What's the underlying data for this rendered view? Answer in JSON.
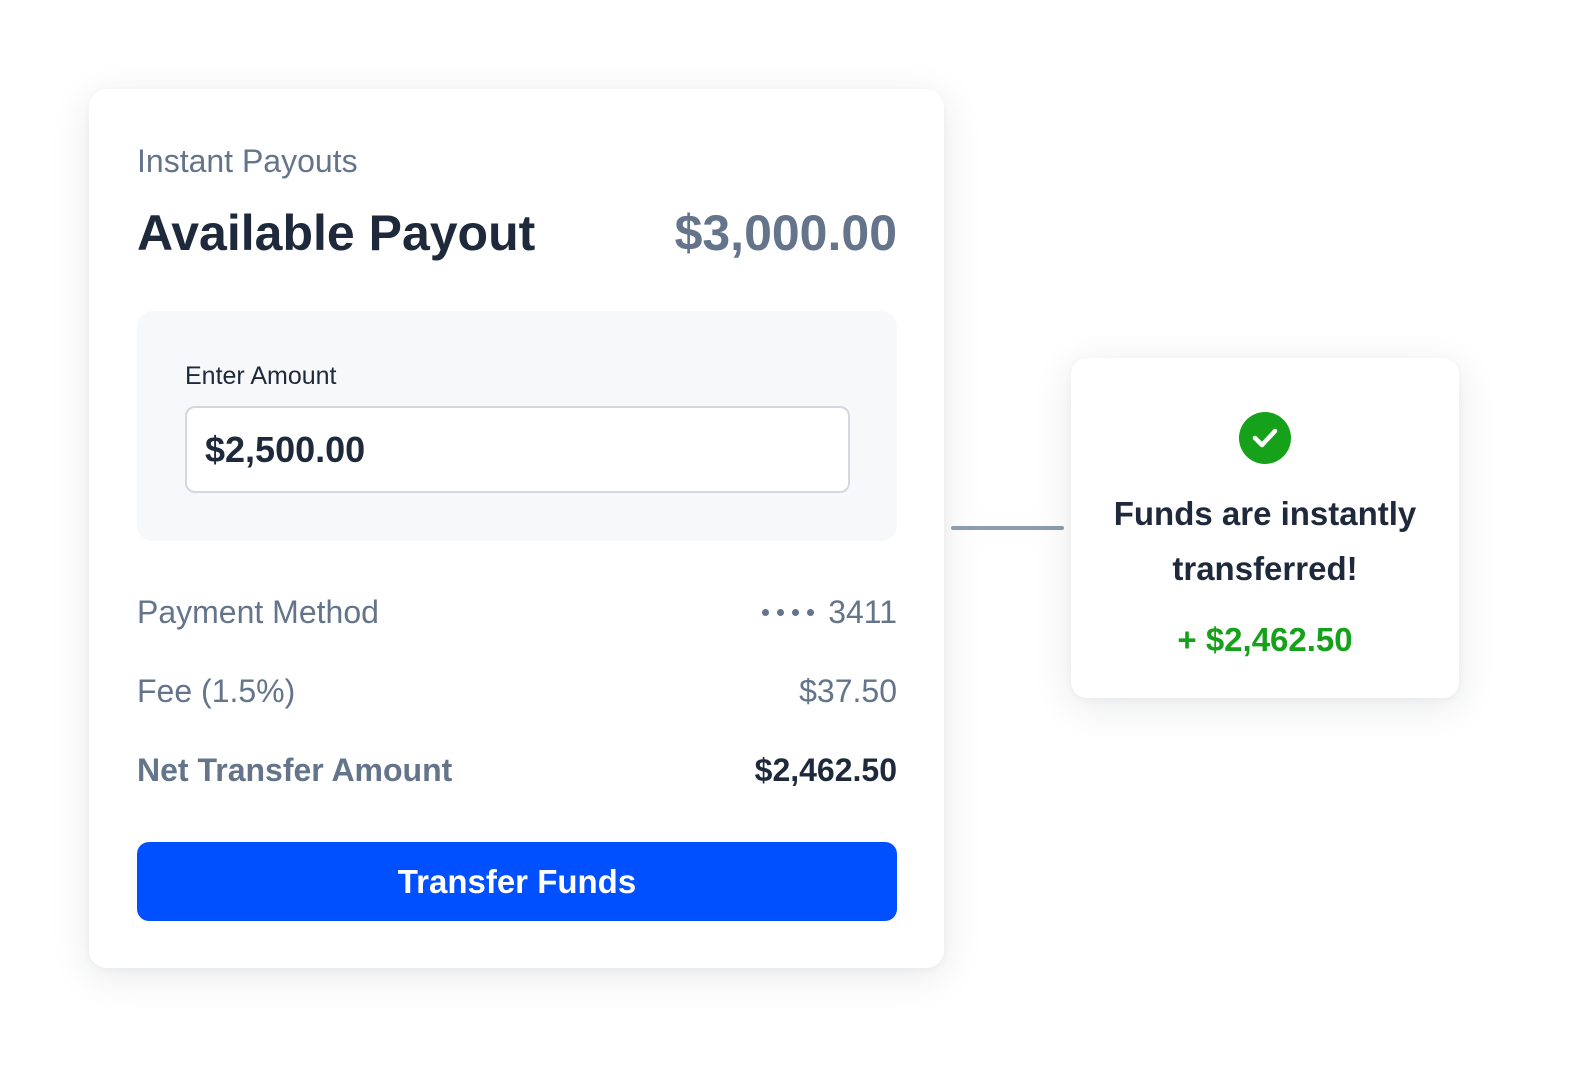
{
  "payout_card": {
    "eyebrow": "Instant Payouts",
    "title": "Available Payout",
    "available_amount": "$3,000.00",
    "amount_field": {
      "label": "Enter Amount",
      "value": "$2,500.00"
    },
    "payment_method": {
      "label": "Payment Method",
      "mask_icon": "masked-card-dots",
      "last4": "3411"
    },
    "fee": {
      "label": "Fee (1.5%)",
      "value": "$37.50"
    },
    "net_transfer": {
      "label": "Net Transfer Amount",
      "value": "$2,462.50"
    },
    "transfer_button_label": "Transfer Funds"
  },
  "success_toast": {
    "icon": "check-circle-icon",
    "message": "Funds are instantly transferred!",
    "amount": "+ $2,462.50"
  },
  "colors": {
    "primary": "#0050ff",
    "success": "#16a11a",
    "text_dark": "#1e293b",
    "text_muted": "#64748b",
    "panel_bg": "#f7f8fa"
  }
}
